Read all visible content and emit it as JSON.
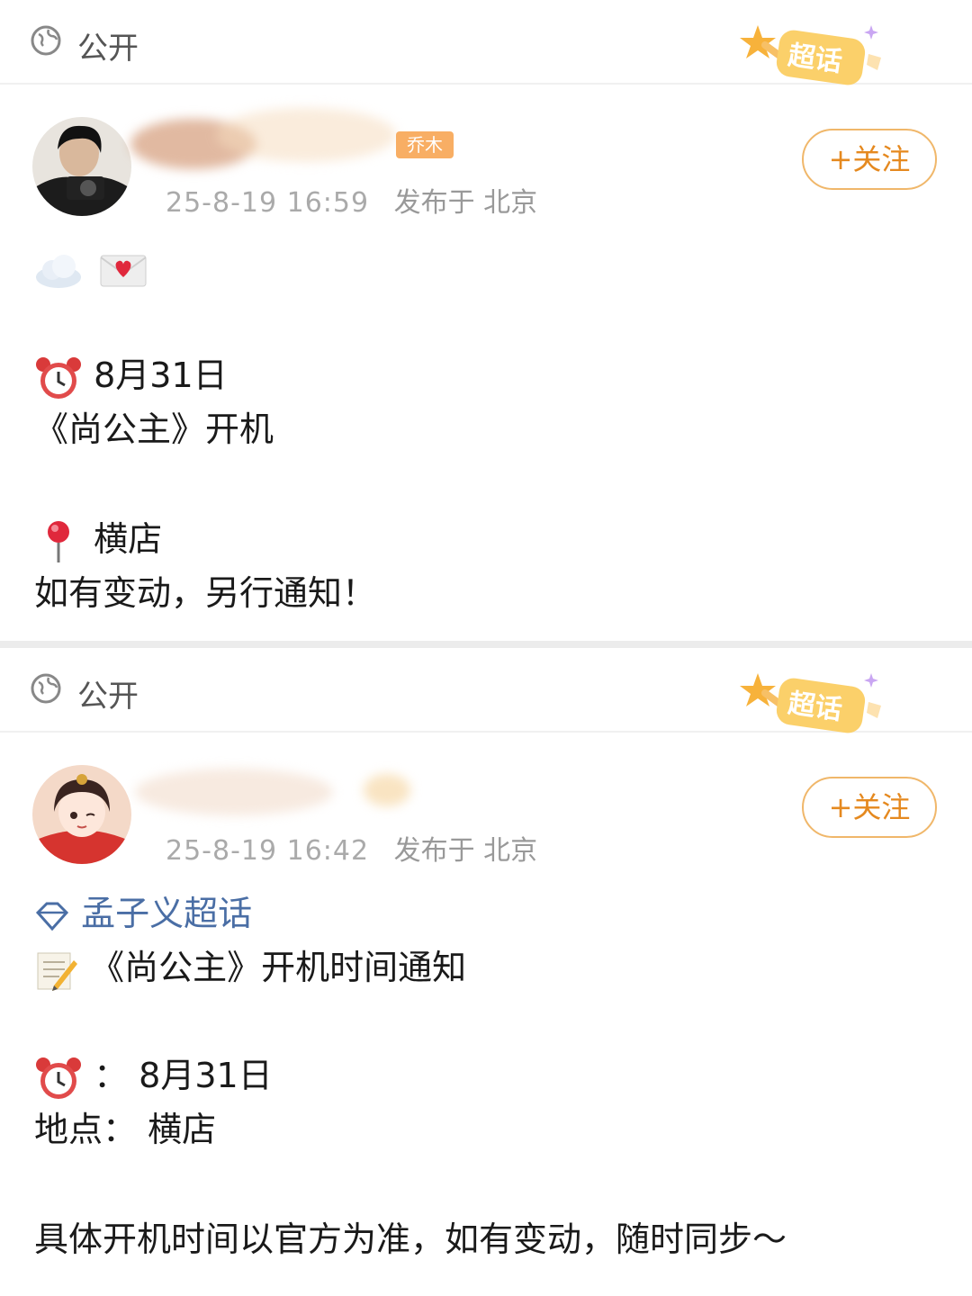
{
  "posts": [
    {
      "visibility": "公开",
      "super_topic_badge": "超话",
      "time": "25-8-19 16:59",
      "location": "发布于 北京",
      "member_tag": "乔木",
      "follow_label": "+关注",
      "lines": {
        "date": "8月31日",
        "title": "《尚公主》开机",
        "place": "横店",
        "notice": "如有变动，另行通知！"
      }
    },
    {
      "visibility": "公开",
      "super_topic_badge": "超话",
      "time": "25-8-19 16:42",
      "location": "发布于 北京",
      "follow_label": "+关注",
      "lines": {
        "topic": "孟子义超话",
        "title": "《尚公主》开机时间通知",
        "date": "：  8月31日",
        "place": "地点：  横店",
        "notice": "具体开机时间以官方为准，如有变动，随时同步～"
      }
    }
  ],
  "colors": {
    "accent_orange": "#e5891f",
    "follow_border": "#f0b76a",
    "topic_blue": "#4a6ea5",
    "meta_gray": "#aaaaaa"
  }
}
